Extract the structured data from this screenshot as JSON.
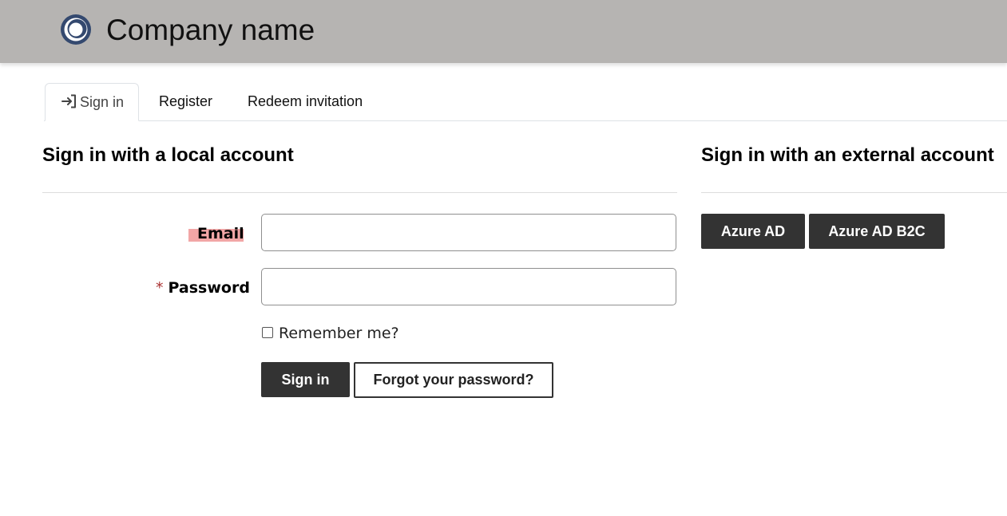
{
  "header": {
    "company_name": "Company name",
    "logo_icon": "ring-logo-icon",
    "background_color": "#b6b4b2",
    "logo_color": "#34496f"
  },
  "tabs": [
    {
      "label": "Sign in",
      "icon": "sign-in-arrow-icon",
      "active": true
    },
    {
      "label": "Register",
      "active": false
    },
    {
      "label": "Redeem invitation",
      "active": false
    }
  ],
  "local": {
    "heading": "Sign in with a local account",
    "email": {
      "label": "Email",
      "value": "",
      "placeholder": ""
    },
    "password": {
      "required_mark": "*",
      "label": "Password",
      "value": "",
      "placeholder": ""
    },
    "remember_me": {
      "label": "Remember me?",
      "checked": false
    },
    "signin_button": "Sign in",
    "forgot_button": "Forgot your password?"
  },
  "external": {
    "heading": "Sign in with an external account",
    "providers": [
      "Azure AD",
      "Azure AD B2C"
    ]
  },
  "colors": {
    "button_dark": "#333333",
    "required_star": "#aa3333",
    "email_highlight": "#f2a6a6"
  }
}
